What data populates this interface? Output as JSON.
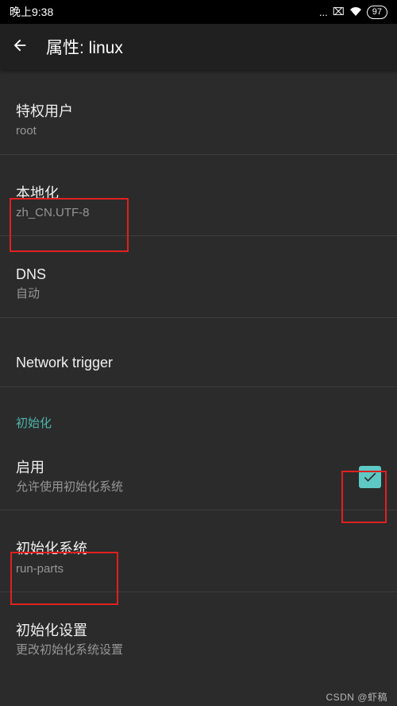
{
  "status": {
    "time": "晚上9:38",
    "battery": "97"
  },
  "header": {
    "title": "属性: linux"
  },
  "items": {
    "privileged": {
      "title": "特权用户",
      "sub": "root"
    },
    "locale": {
      "title": "本地化",
      "sub": "zh_CN.UTF-8"
    },
    "dns": {
      "title": "DNS",
      "sub": "自动"
    },
    "nettrigger": {
      "title": "Network trigger"
    }
  },
  "section": {
    "init": "初始化"
  },
  "init_enable": {
    "title": "启用",
    "sub": "允许使用初始化系统",
    "checked": true
  },
  "init_system": {
    "title": "初始化系统",
    "sub": "run-parts"
  },
  "init_settings": {
    "title": "初始化设置",
    "sub": "更改初始化系统设置"
  },
  "watermark": "CSDN @虾稿"
}
